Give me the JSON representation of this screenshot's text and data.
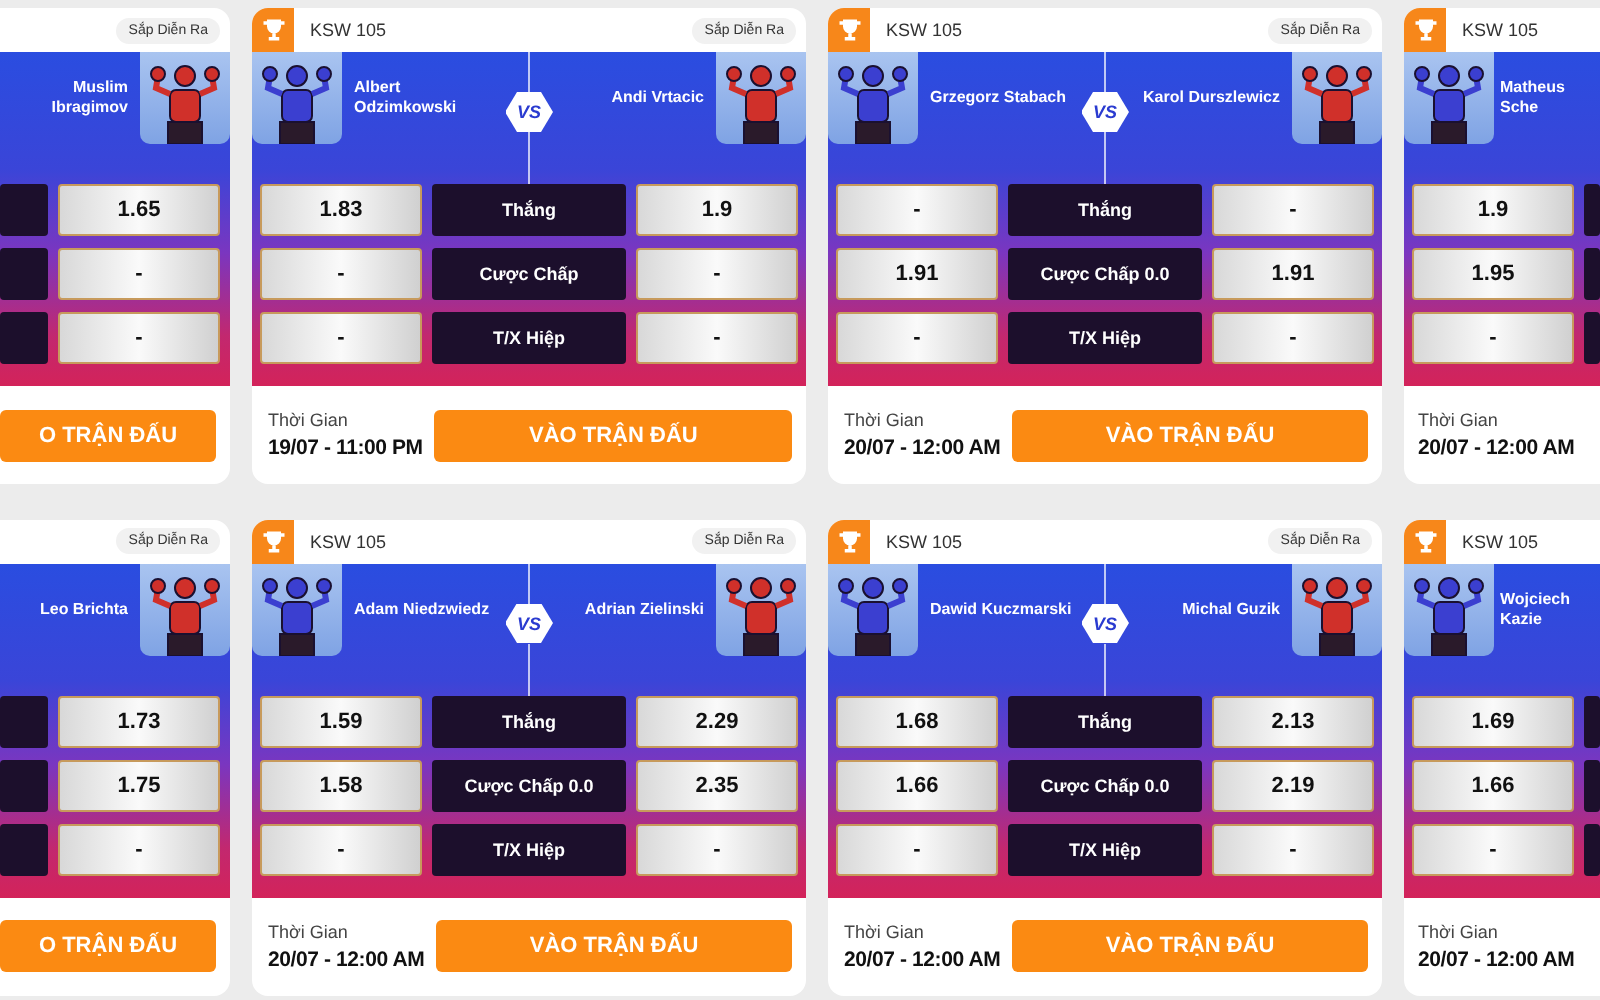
{
  "cards": [
    {
      "kind": "left_part",
      "status": "Sắp Diễn Ra",
      "away": "Muslim Ibragimov",
      "markets": [
        {
          "odds_away": "1.65"
        },
        {
          "odds_away": "-"
        },
        {
          "odds_away": "-"
        }
      ],
      "button": "O TRẬN ĐẤU"
    },
    {
      "kind": "full",
      "event": "KSW 105",
      "status": "Sắp Diễn Ra",
      "home": "Albert Odzimkowski",
      "vs": "VS",
      "away": "Andi Vrtacic",
      "markets": [
        {
          "label": "Thắng",
          "odds_home": "1.83",
          "odds_away": "1.9"
        },
        {
          "label": "Cược Chấp",
          "odds_home": "-",
          "odds_away": "-"
        },
        {
          "label": "T/X Hiệp",
          "odds_home": "-",
          "odds_away": "-"
        }
      ],
      "time_label": "Thời Gian",
      "time": "19/07 - 11:00 PM",
      "button": "VÀO TRẬN ĐẤU"
    },
    {
      "kind": "full",
      "event": "KSW 105",
      "status": "Sắp Diễn Ra",
      "home": "Grzegorz Stabach",
      "vs": "VS",
      "away": "Karol Durszlewicz",
      "markets": [
        {
          "label": "Thắng",
          "odds_home": "-",
          "odds_away": "-"
        },
        {
          "label": "Cược Chấp 0.0",
          "odds_home": "1.91",
          "odds_away": "1.91"
        },
        {
          "label": "T/X Hiệp",
          "odds_home": "-",
          "odds_away": "-"
        }
      ],
      "time_label": "Thời Gian",
      "time": "20/07 - 12:00 AM",
      "button": "VÀO TRẬN ĐẤU"
    },
    {
      "kind": "right_part",
      "event": "KSW 105",
      "home": "Matheus Sche",
      "markets": [
        {
          "odds_home": "1.9"
        },
        {
          "odds_home": "1.95"
        },
        {
          "odds_home": "-"
        }
      ],
      "time_label": "Thời Gian",
      "time": "20/07 - 12:00 AM"
    },
    {
      "kind": "left_part",
      "status": "Sắp Diễn Ra",
      "away": "Leo Brichta",
      "markets": [
        {
          "odds_away": "1.73"
        },
        {
          "odds_away": "1.75"
        },
        {
          "odds_away": "-"
        }
      ],
      "button": "O TRẬN ĐẤU"
    },
    {
      "kind": "full",
      "event": "KSW 105",
      "status": "Sắp Diễn Ra",
      "home": "Adam Niedzwiedz",
      "vs": "VS",
      "away": "Adrian Zielinski",
      "markets": [
        {
          "label": "Thắng",
          "odds_home": "1.59",
          "odds_away": "2.29"
        },
        {
          "label": "Cược Chấp 0.0",
          "odds_home": "1.58",
          "odds_away": "2.35"
        },
        {
          "label": "T/X Hiệp",
          "odds_home": "-",
          "odds_away": "-"
        }
      ],
      "time_label": "Thời Gian",
      "time": "20/07 - 12:00 AM",
      "button": "VÀO TRẬN ĐẤU"
    },
    {
      "kind": "full",
      "event": "KSW 105",
      "status": "Sắp Diễn Ra",
      "home": "Dawid Kuczmarski",
      "vs": "VS",
      "away": "Michal Guzik",
      "markets": [
        {
          "label": "Thắng",
          "odds_home": "1.68",
          "odds_away": "2.13"
        },
        {
          "label": "Cược Chấp 0.0",
          "odds_home": "1.66",
          "odds_away": "2.19"
        },
        {
          "label": "T/X Hiệp",
          "odds_home": "-",
          "odds_away": "-"
        }
      ],
      "time_label": "Thời Gian",
      "time": "20/07 - 12:00 AM",
      "button": "VÀO TRẬN ĐẤU"
    },
    {
      "kind": "right_part",
      "event": "KSW 105",
      "home": "Wojciech Kazie",
      "markets": [
        {
          "odds_home": "1.69"
        },
        {
          "odds_home": "1.66"
        },
        {
          "odds_home": "-"
        }
      ],
      "time_label": "Thời Gian",
      "time": "20/07 - 12:00 AM"
    }
  ]
}
